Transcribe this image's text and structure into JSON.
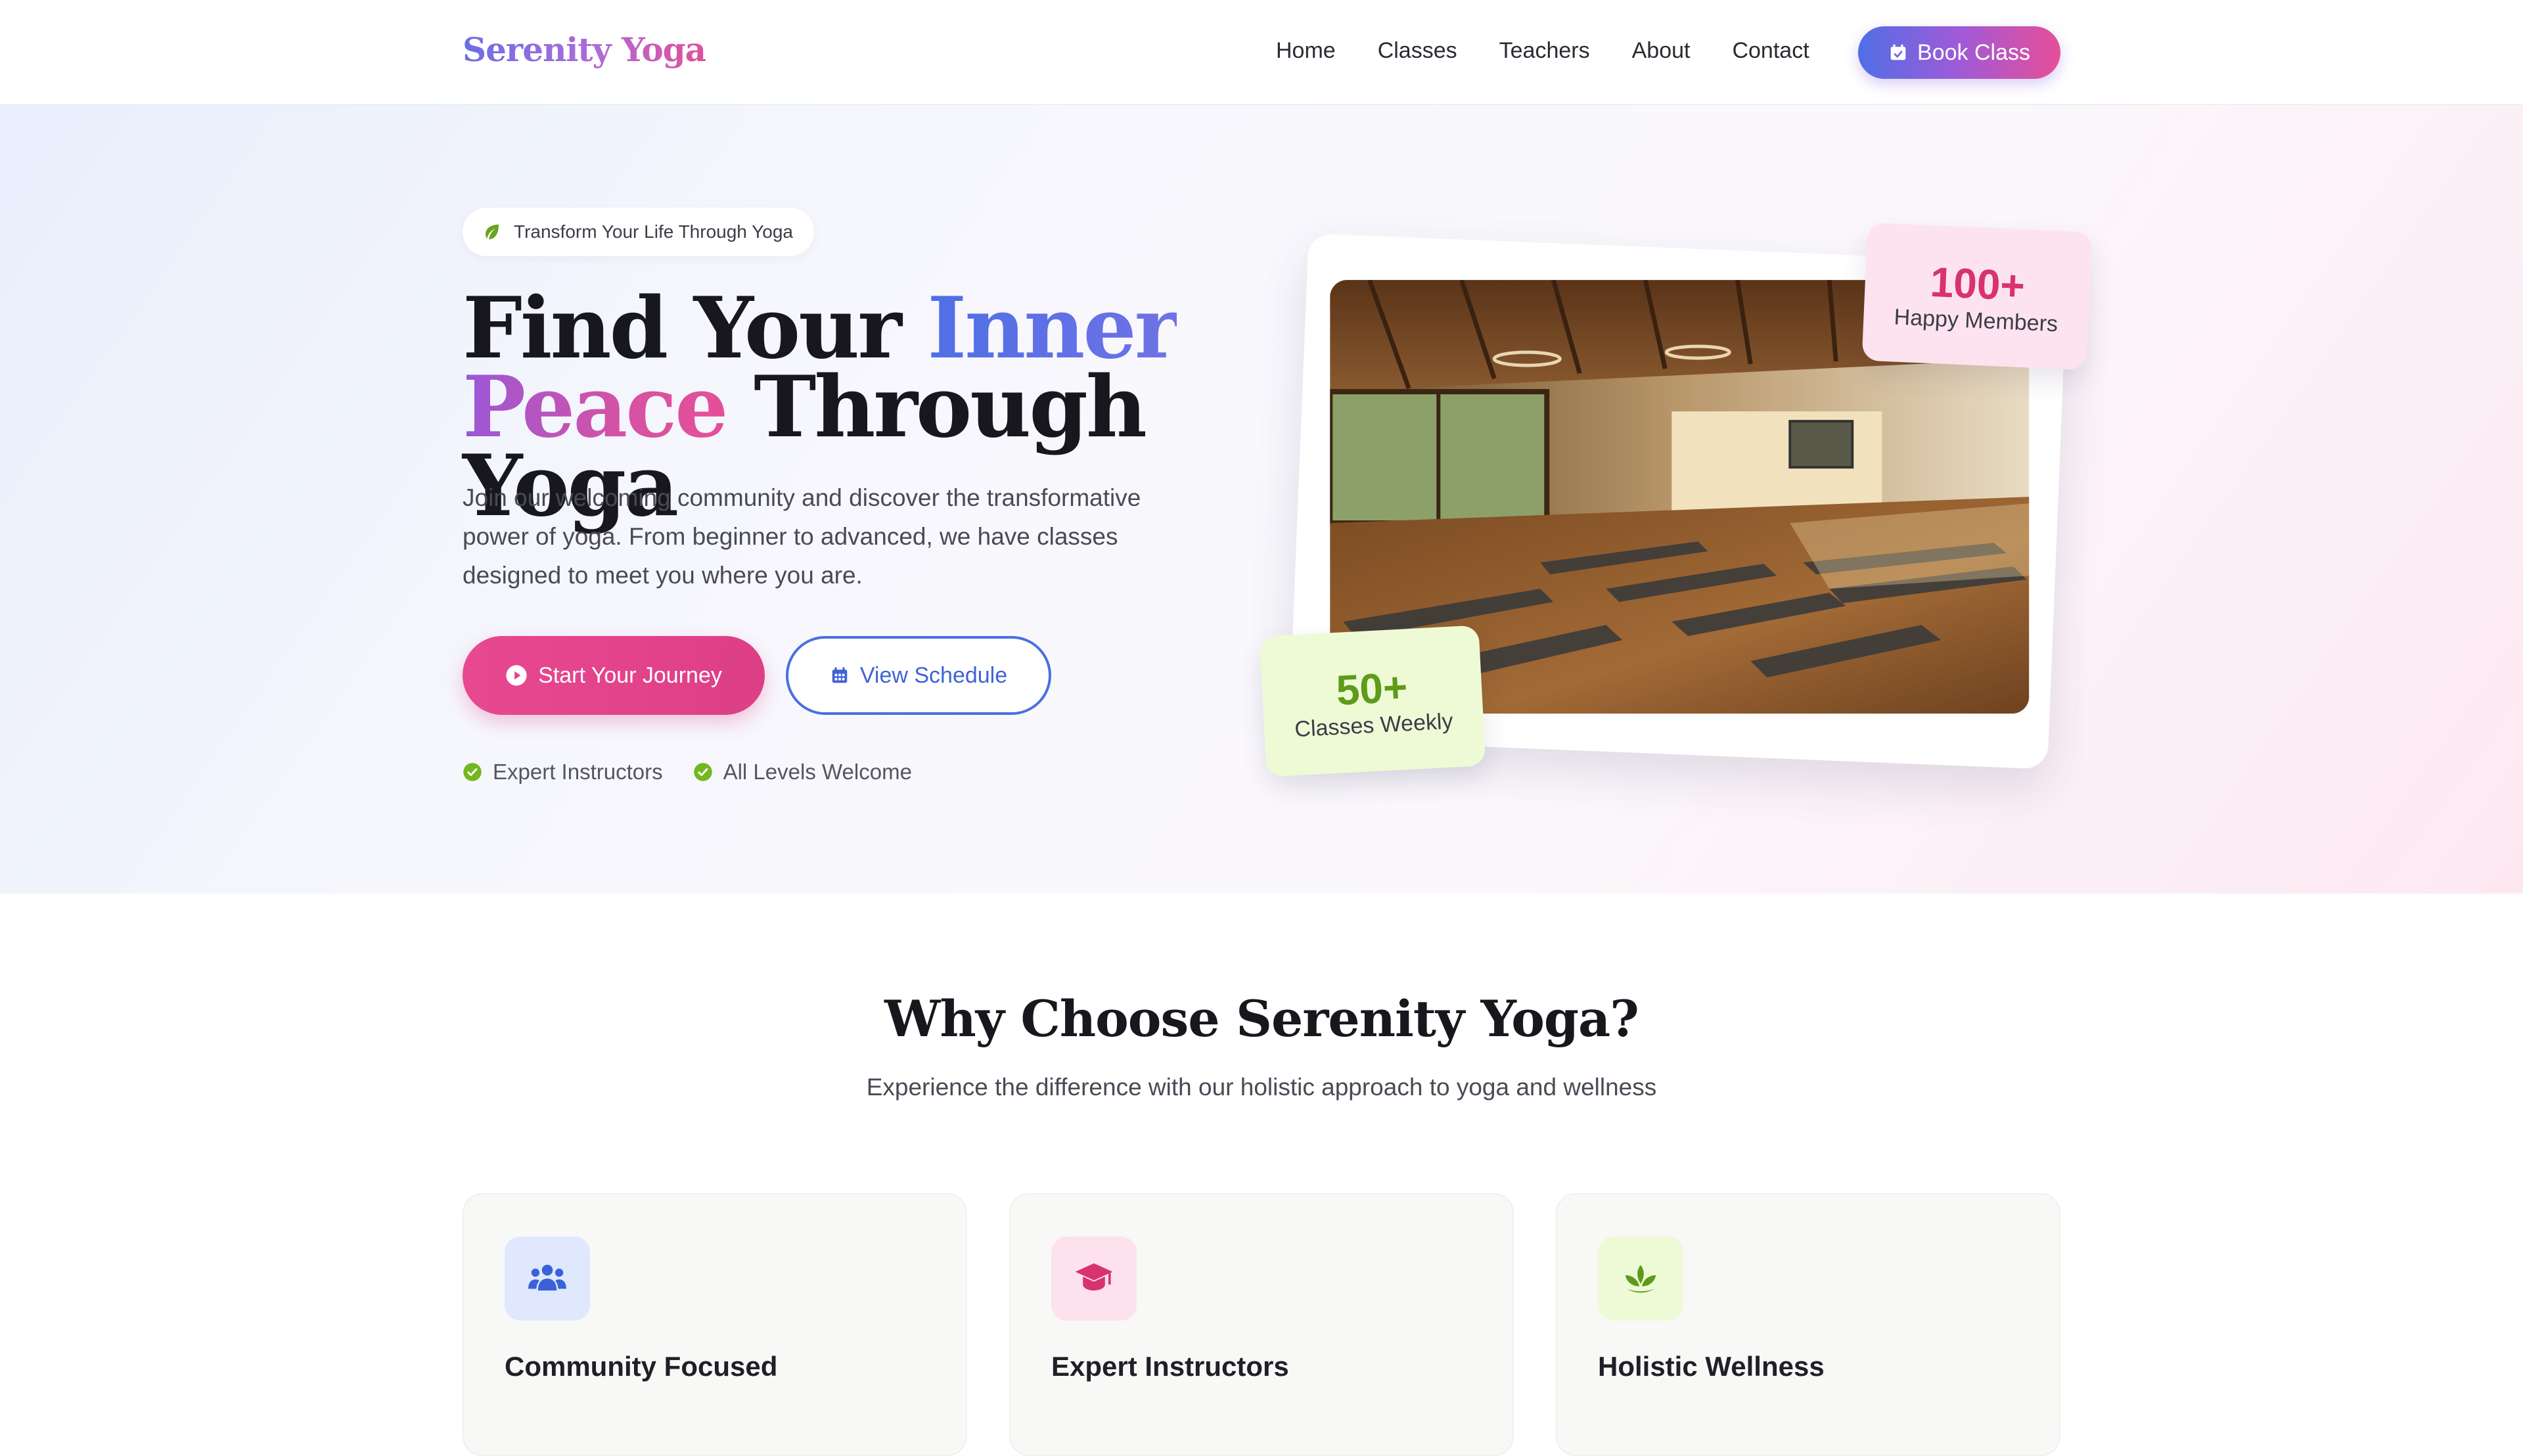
{
  "nav": {
    "brand": "Serenity Yoga",
    "links": [
      "Home",
      "Classes",
      "Teachers",
      "About",
      "Contact"
    ],
    "cta_label": "Book Class",
    "cta_icon": "calendar-check-icon"
  },
  "hero": {
    "tag": "Transform Your Life Through Yoga",
    "tag_icon": "leaf-icon",
    "title_part1": "Find Your ",
    "title_accent1": "Inner",
    "title_accent2": "Peace",
    "title_part2": " Through Yoga",
    "description": "Join our welcoming community and discover the transformative power of yoga. From beginner to advanced, we have classes designed to meet you where you are.",
    "primary_button": "Start Your Journey",
    "primary_icon": "play-circle-icon",
    "secondary_button": "View Schedule",
    "secondary_icon": "calendar-icon",
    "checks": [
      "Expert Instructors",
      "All Levels Welcome"
    ],
    "stats": [
      {
        "value": "100+",
        "label": "Happy Members"
      },
      {
        "value": "50+",
        "label": "Classes Weekly"
      }
    ]
  },
  "why": {
    "title": "Why Choose Serenity Yoga?",
    "subtitle": "Experience the difference with our holistic approach to yoga and wellness",
    "features": [
      {
        "title": "Community Focused",
        "icon": "users-icon"
      },
      {
        "title": "Expert Instructors",
        "icon": "graduation-cap-icon"
      },
      {
        "title": "Holistic Wellness",
        "icon": "lotus-icon"
      }
    ]
  },
  "colors": {
    "blue": "#4f6fe6",
    "pink": "#e8488f",
    "green": "#6aa321",
    "purple": "#a05ad8"
  }
}
